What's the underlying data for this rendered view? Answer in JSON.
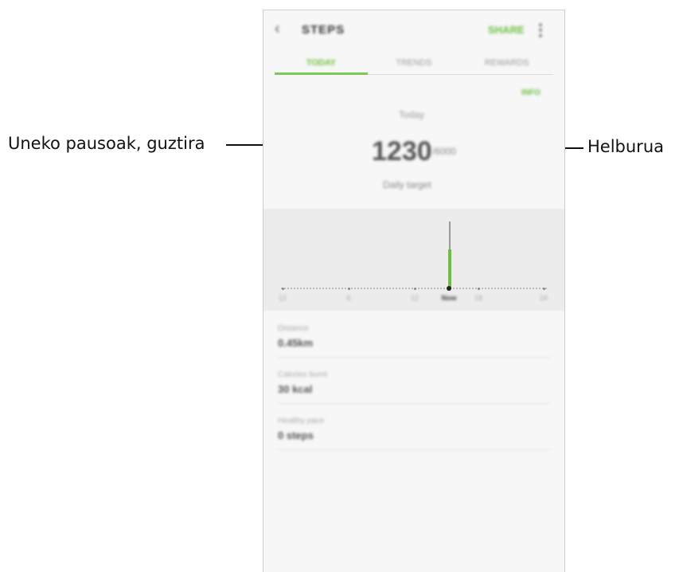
{
  "callouts": {
    "left_label": "Uneko pausoak, guztira",
    "right_label": "Helburua"
  },
  "app": {
    "title": "STEPS",
    "share_label": "SHARE",
    "back_icon": "back-arrow-icon",
    "more_icon": "more-vert-icon"
  },
  "tabs": [
    {
      "label": "TODAY",
      "active": true
    },
    {
      "label": "TRENDS",
      "active": false
    },
    {
      "label": "REWARDS",
      "active": false
    }
  ],
  "summary": {
    "info_label": "INFO",
    "today_label": "Today",
    "steps_count": "1230",
    "goal_value": "/6000",
    "target_text": "Daily target"
  },
  "chart_data": {
    "type": "bar",
    "categories": [
      "12",
      "6",
      "12",
      "Now",
      "18",
      "24"
    ],
    "series": [
      {
        "values": [
          0,
          0,
          0,
          1230,
          0,
          0
        ]
      }
    ],
    "selected": "Now",
    "accent_color": "#6cbf3f"
  },
  "stats": [
    {
      "label": "Distance",
      "value": "0.45km"
    },
    {
      "label": "Calories burnt",
      "value": "30 kcal"
    },
    {
      "label": "Healthy pace",
      "value": "0 steps"
    }
  ]
}
